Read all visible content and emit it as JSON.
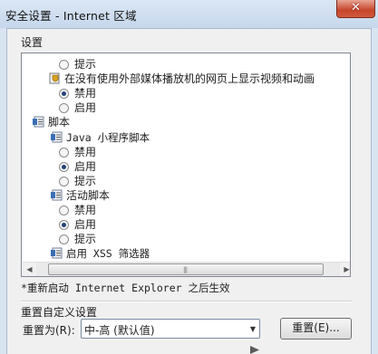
{
  "window": {
    "title": "安全设置 - Internet 区域"
  },
  "settings_group_label": "设置",
  "tree": [
    {
      "kind": "radio",
      "label": "提示",
      "checked": false
    },
    {
      "kind": "setting",
      "label": "在没有使用外部媒体播放机的网页上显示视频和动画",
      "icon": "shield-settings-icon"
    },
    {
      "kind": "radio",
      "label": "禁用",
      "checked": true
    },
    {
      "kind": "radio",
      "label": "启用",
      "checked": false
    },
    {
      "kind": "category",
      "label": "脚本",
      "icon": "settings-list-icon"
    },
    {
      "kind": "setting",
      "label": "Java 小程序脚本",
      "icon": "settings-list-icon"
    },
    {
      "kind": "radio",
      "label": "禁用",
      "checked": false
    },
    {
      "kind": "radio",
      "label": "启用",
      "checked": true
    },
    {
      "kind": "radio",
      "label": "提示",
      "checked": false
    },
    {
      "kind": "setting",
      "label": "活动脚本",
      "icon": "settings-list-icon"
    },
    {
      "kind": "radio",
      "label": "禁用",
      "checked": false
    },
    {
      "kind": "radio",
      "label": "启用",
      "checked": true
    },
    {
      "kind": "radio",
      "label": "提示",
      "checked": false
    },
    {
      "kind": "setting",
      "label": "启用 XSS 筛选器",
      "icon": "settings-list-icon"
    }
  ],
  "restart_note": "*重新启动 Internet Explorer 之后生效",
  "reset_group_label": "重置自定义设置",
  "reset_to_label": "重置为(R):",
  "reset_level": "中-高 (默认值)",
  "reset_button_label": "重置(E)..."
}
